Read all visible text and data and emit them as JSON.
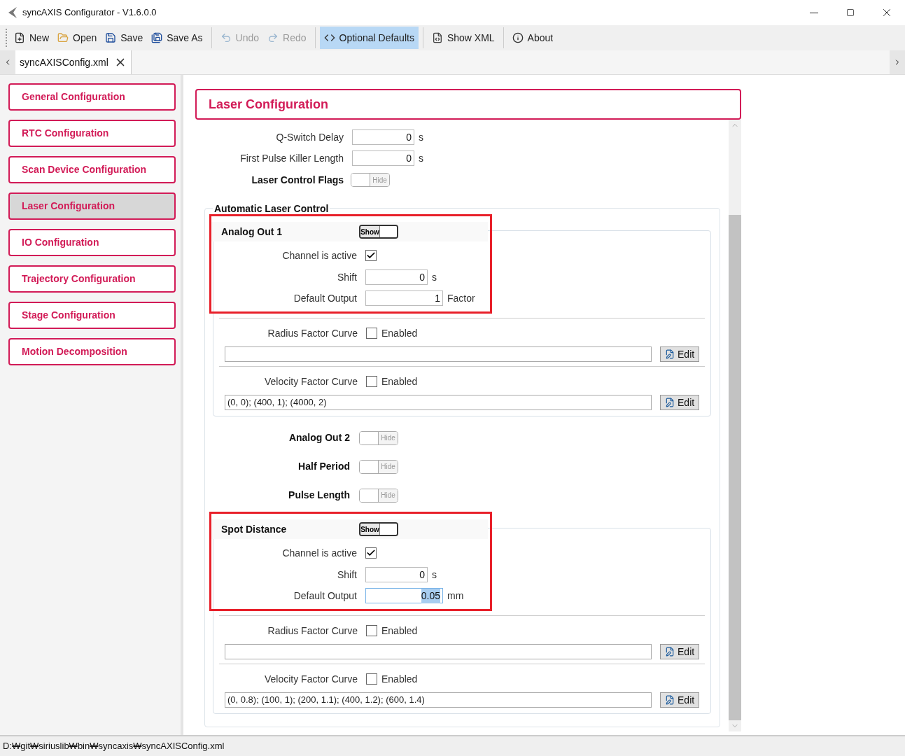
{
  "window": {
    "title": "syncAXIS Configurator - V1.6.0.0"
  },
  "toolbar": {
    "groups": [
      {
        "items": [
          {
            "kind": "new",
            "label": "New",
            "disabled": false,
            "selected": false
          },
          {
            "kind": "open",
            "label": "Open",
            "disabled": false,
            "selected": false
          },
          {
            "kind": "save",
            "label": "Save",
            "disabled": false,
            "selected": false
          },
          {
            "kind": "saveas",
            "label": "Save As",
            "disabled": false,
            "selected": false
          }
        ]
      },
      {
        "items": [
          {
            "kind": "undo",
            "label": "Undo",
            "disabled": true,
            "selected": false
          },
          {
            "kind": "redo",
            "label": "Redo",
            "disabled": true,
            "selected": false
          }
        ]
      },
      {
        "items": [
          {
            "kind": "code",
            "label": "Optional Defaults",
            "disabled": false,
            "selected": true
          }
        ]
      },
      {
        "items": [
          {
            "kind": "xml",
            "label": "Show XML",
            "disabled": false,
            "selected": false
          }
        ]
      },
      {
        "items": [
          {
            "kind": "info",
            "label": "About",
            "disabled": false,
            "selected": false
          }
        ]
      }
    ]
  },
  "tabs": [
    {
      "label": "syncAXISConfig.xml",
      "selected": true
    }
  ],
  "sidebar": {
    "items": [
      {
        "label": "General Configuration",
        "selected": false
      },
      {
        "label": "RTC Configuration",
        "selected": false
      },
      {
        "label": "Scan Device Configuration",
        "selected": false
      },
      {
        "label": "Laser Configuration",
        "selected": true
      },
      {
        "label": "IO Configuration",
        "selected": false
      },
      {
        "label": "Trajectory Configuration",
        "selected": false
      },
      {
        "label": "Stage Configuration",
        "selected": false
      },
      {
        "label": "Motion Decomposition",
        "selected": false
      }
    ]
  },
  "page": {
    "title": "Laser Configuration",
    "fields": [
      {
        "label": "Q-Switch Delay",
        "value": "0",
        "unit": "s"
      },
      {
        "label": "First Pulse Killer Length",
        "value": "0",
        "unit": "s"
      }
    ],
    "flags": {
      "label": "Laser Control Flags",
      "toggle": {
        "text": "Hide",
        "on": false
      }
    },
    "automatic_laser_control": {
      "title": "Automatic Laser Control",
      "channels": [
        {
          "name": "Analog Out 1",
          "toggle": {
            "text": "Show",
            "on": true
          },
          "highlighted": true,
          "channel_active": {
            "label": "Channel is active",
            "checked": true
          },
          "fields": [
            {
              "label": "Shift",
              "value": "0",
              "unit": "s",
              "focused": false
            },
            {
              "label": "Default Output",
              "value": "1",
              "unit": "Factor",
              "focused": false
            }
          ],
          "curves": [
            {
              "label": "Radius Factor Curve",
              "checkbox_label": "Enabled",
              "checked": false,
              "button": "Edit"
            },
            {
              "label": "Velocity Factor Curve",
              "checkbox_label": "Enabled",
              "checked": false,
              "value": "(0, 0); (400, 1); (4000, 2)",
              "button": "Edit"
            }
          ]
        },
        {
          "name": "Analog Out 2",
          "toggle": {
            "text": "Hide",
            "on": false
          }
        },
        {
          "name": "Half Period",
          "toggle": {
            "text": "Hide",
            "on": false
          }
        },
        {
          "name": "Pulse Length",
          "toggle": {
            "text": "Hide",
            "on": false
          }
        },
        {
          "name": "Spot Distance",
          "toggle": {
            "text": "Show",
            "on": true
          },
          "highlighted": true,
          "channel_active": {
            "label": "Channel is active",
            "checked": true
          },
          "fields": [
            {
              "label": "Shift",
              "value": "0",
              "unit": "s",
              "focused": false
            },
            {
              "label": "Default Output",
              "value": "0.05",
              "unit": "mm",
              "focused": true
            }
          ],
          "curves": [
            {
              "label": "Radius Factor Curve",
              "checkbox_label": "Enabled",
              "checked": false,
              "button": "Edit"
            },
            {
              "label": "Velocity Factor Curve",
              "checkbox_label": "Enabled",
              "checked": false,
              "value": "(0, 0.8); (100, 1); (200, 1.1); (400, 1.2); (600, 1.4)",
              "button": "Edit"
            }
          ]
        }
      ]
    }
  },
  "status_bar": {
    "path": "D:₩git₩siriuslib₩bin₩syncaxis₩syncAXISConfig.xml"
  }
}
